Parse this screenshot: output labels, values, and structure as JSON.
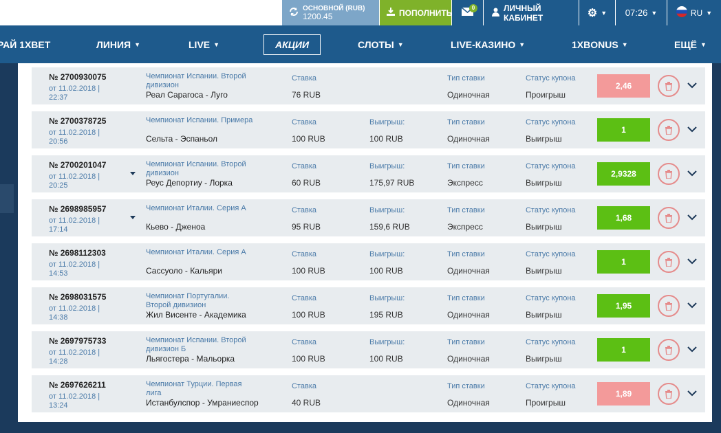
{
  "topbar": {
    "balance_label": "ОСНОВНОЙ (RUB)",
    "balance_value": "1200.45",
    "deposit_label": "ПОПОЛНИТЬ",
    "mail_badge": "0",
    "cabinet_label": "ЛИЧНЫЙ КАБИНЕТ",
    "time": "07:26",
    "lang": "RU"
  },
  "nav": {
    "items": [
      "РАЙ 1XBET",
      "ЛИНИЯ",
      "LIVE",
      "АКЦИИ",
      "СЛОТЫ",
      "LIVE-КАЗИНО",
      "1XBONUS",
      "ЕЩЁ"
    ]
  },
  "labels": {
    "stake": "Ставка",
    "win": "Выигрыш:",
    "bet_type": "Тип ставки",
    "status": "Статус купона"
  },
  "colors": {
    "win": "#5cbf14",
    "loss": "#f39a9a",
    "nav": "#1e5a8c",
    "deposit": "#7fb22a",
    "balance": "#7da6c8"
  },
  "bets": [
    {
      "number": "№ 2700930075",
      "date": "от 11.02.2018 | 22:37",
      "league": "Чемпионат Испании. Второй дивизион",
      "match": "Реал Сарагоса - Луго",
      "stake": "76 RUB",
      "win": "",
      "type": "Одиночная",
      "status": "Проигрыш",
      "coef": "2,46",
      "result": "loss",
      "caret": false
    },
    {
      "number": "№ 2700378725",
      "date": "от 11.02.2018 | 20:56",
      "league": "Чемпионат Испании. Примера",
      "match": "Сельта - Эспаньол",
      "stake": "100 RUB",
      "win": "100 RUB",
      "type": "Одиночная",
      "status": "Выигрыш",
      "coef": "1",
      "result": "win",
      "caret": false
    },
    {
      "number": "№ 2700201047",
      "date": "от 11.02.2018 | 20:25",
      "league": "Чемпионат Испании. Второй дивизион",
      "match": "Реус Депортиу - Лорка",
      "stake": "60 RUB",
      "win": "175,97 RUB",
      "type": "Экспресс",
      "status": "Выигрыш",
      "coef": "2,9328",
      "result": "win",
      "caret": true
    },
    {
      "number": "№ 2698985957",
      "date": "от 11.02.2018 | 17:14",
      "league": "Чемпионат Италии. Серия А",
      "match": "Кьево - Дженоа",
      "stake": "95 RUB",
      "win": "159,6 RUB",
      "type": "Экспресс",
      "status": "Выигрыш",
      "coef": "1,68",
      "result": "win",
      "caret": true
    },
    {
      "number": "№ 2698112303",
      "date": "от 11.02.2018 | 14:53",
      "league": "Чемпионат Италии. Серия А",
      "match": "Сассуоло - Кальяри",
      "stake": "100 RUB",
      "win": "100 RUB",
      "type": "Одиночная",
      "status": "Выигрыш",
      "coef": "1",
      "result": "win",
      "caret": false
    },
    {
      "number": "№ 2698031575",
      "date": "от 11.02.2018 | 14:38",
      "league": "Чемпионат Португалии. Второй дивизион",
      "match": "Жил Висенте - Академика",
      "stake": "100 RUB",
      "win": "195 RUB",
      "type": "Одиночная",
      "status": "Выигрыш",
      "coef": "1,95",
      "result": "win",
      "caret": false
    },
    {
      "number": "№ 2697975733",
      "date": "от 11.02.2018 | 14:28",
      "league": "Чемпионат Испании. Второй дивизион Б",
      "match": "Льягостера - Мальорка",
      "stake": "100 RUB",
      "win": "100 RUB",
      "type": "Одиночная",
      "status": "Выигрыш",
      "coef": "1",
      "result": "win",
      "caret": false
    },
    {
      "number": "№ 2697626211",
      "date": "от 11.02.2018 | 13:24",
      "league": "Чемпионат Турции. Первая лига",
      "match": "Истанбулспор - Умраниеспор",
      "stake": "40 RUB",
      "win": "",
      "type": "Одиночная",
      "status": "Проигрыш",
      "coef": "1,89",
      "result": "loss",
      "caret": false
    }
  ]
}
